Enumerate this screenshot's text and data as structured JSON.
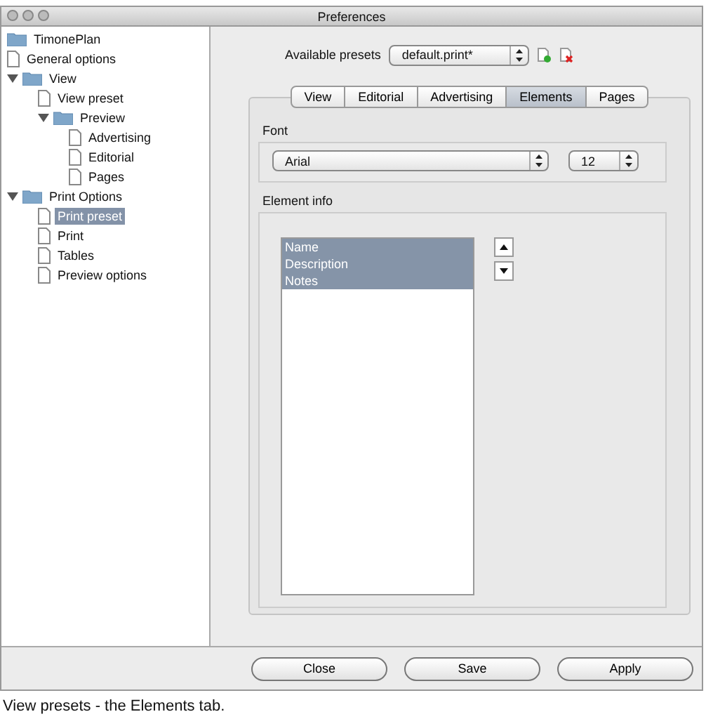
{
  "window": {
    "title": "Preferences"
  },
  "sidebar": {
    "items": [
      {
        "label": "TimonePlan",
        "kind": "folder",
        "selected": false
      },
      {
        "label": "General options",
        "kind": "file",
        "selected": false
      },
      {
        "label": "View",
        "kind": "folder",
        "expanded": true,
        "selected": false,
        "children": [
          {
            "label": "View preset",
            "kind": "file",
            "selected": false
          },
          {
            "label": "Preview",
            "kind": "folder",
            "expanded": true,
            "selected": false,
            "children": [
              {
                "label": "Advertising",
                "kind": "file",
                "selected": false
              },
              {
                "label": "Editorial",
                "kind": "file",
                "selected": false
              },
              {
                "label": "Pages",
                "kind": "file",
                "selected": false
              }
            ]
          }
        ]
      },
      {
        "label": "Print Options",
        "kind": "folder",
        "expanded": true,
        "selected": false,
        "children": [
          {
            "label": "Print preset",
            "kind": "file",
            "selected": true
          },
          {
            "label": "Print",
            "kind": "file",
            "selected": false
          },
          {
            "label": "Tables",
            "kind": "file",
            "selected": false
          },
          {
            "label": "Preview options",
            "kind": "file",
            "selected": false
          }
        ]
      }
    ]
  },
  "presets": {
    "label": "Available presets",
    "value": "default.print*"
  },
  "tabs": [
    {
      "label": "View",
      "selected": false
    },
    {
      "label": "Editorial",
      "selected": false
    },
    {
      "label": "Advertising",
      "selected": false
    },
    {
      "label": "Elements",
      "selected": true
    },
    {
      "label": "Pages",
      "selected": false
    }
  ],
  "font": {
    "label": "Font",
    "family": "Arial",
    "size": "12"
  },
  "element_info": {
    "label": "Element info",
    "items": [
      {
        "label": "Name",
        "selected": true
      },
      {
        "label": "Description",
        "selected": true
      },
      {
        "label": "Notes",
        "selected": true
      }
    ]
  },
  "buttons": [
    "Close",
    "Save",
    "Apply"
  ],
  "caption": "View presets - the Elements tab."
}
